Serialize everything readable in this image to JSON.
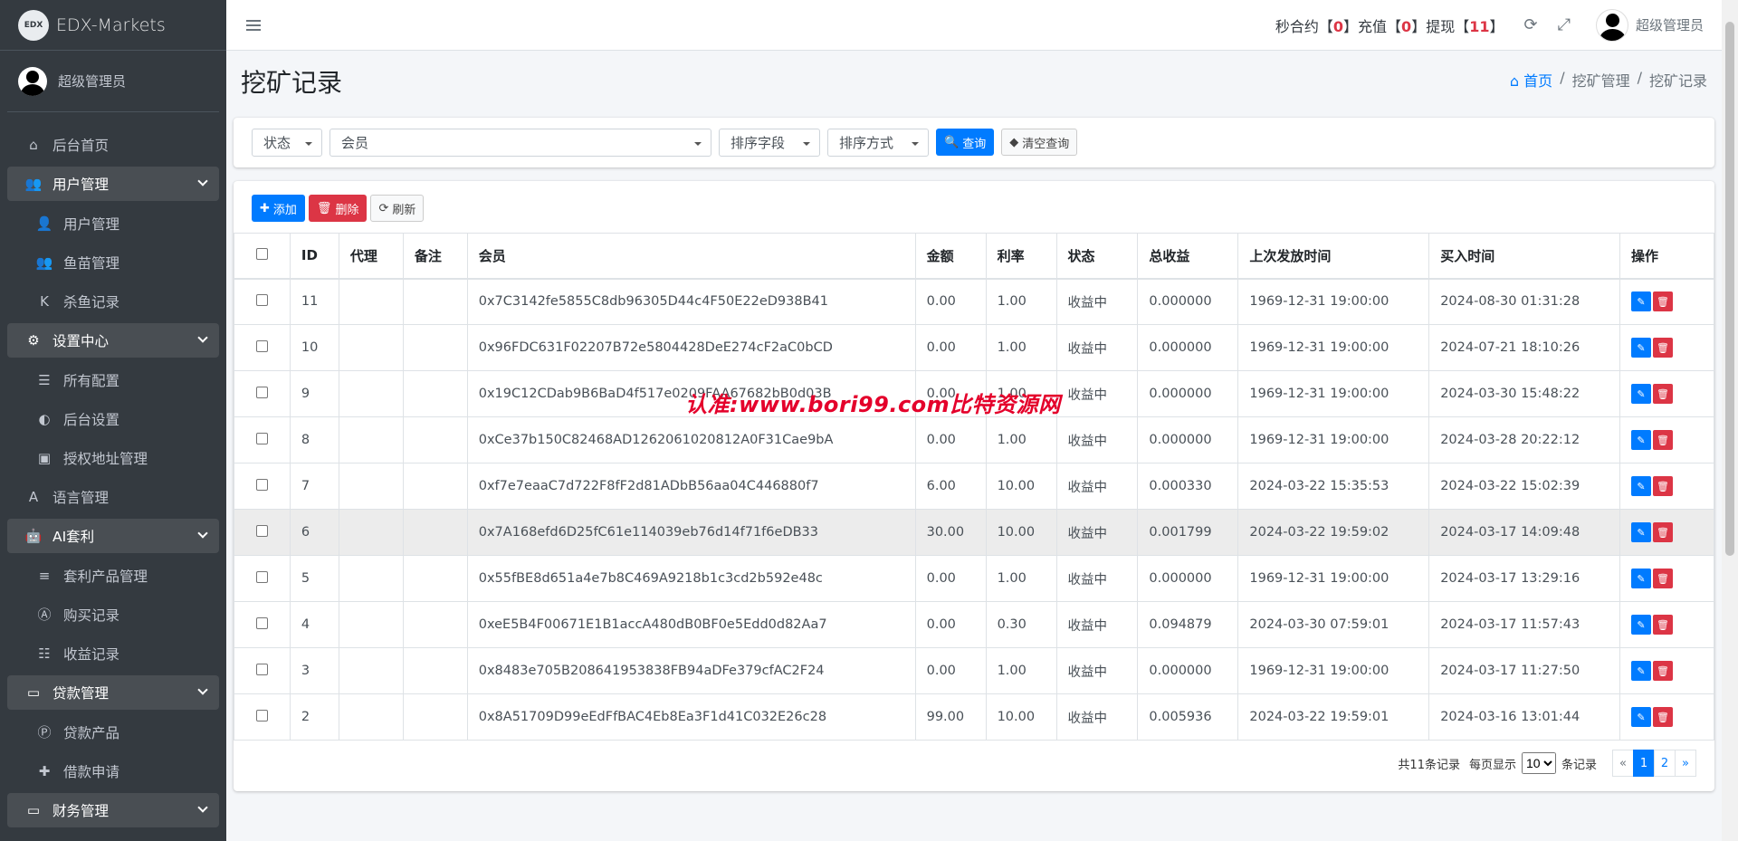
{
  "brand": {
    "logo": "EDX",
    "name": "EDX-Markets"
  },
  "sidebar": {
    "user_name": "超级管理员",
    "items": [
      {
        "label": "后台首页",
        "icon": "home-icon",
        "glyph": "⌂",
        "type": "top"
      },
      {
        "label": "用户管理",
        "icon": "users-icon",
        "glyph": "👥",
        "type": "parent"
      },
      {
        "label": "用户管理",
        "icon": "user-icon",
        "glyph": "👤",
        "type": "child"
      },
      {
        "label": "鱼苗管理",
        "icon": "users-icon",
        "glyph": "👥",
        "type": "child"
      },
      {
        "label": "杀鱼记录",
        "icon": "k-icon",
        "glyph": "K",
        "type": "child"
      },
      {
        "label": "设置中心",
        "icon": "cogs-icon",
        "glyph": "⚙",
        "type": "parent"
      },
      {
        "label": "所有配置",
        "icon": "list-icon",
        "glyph": "☰",
        "type": "child"
      },
      {
        "label": "后台设置",
        "icon": "adjust-icon",
        "glyph": "◐",
        "type": "child"
      },
      {
        "label": "授权地址管理",
        "icon": "id-card-icon",
        "glyph": "▣",
        "type": "child"
      },
      {
        "label": "语言管理",
        "icon": "language-icon",
        "glyph": "A",
        "type": "top"
      },
      {
        "label": "AI套利",
        "icon": "android-icon",
        "glyph": "🤖",
        "type": "parent"
      },
      {
        "label": "套利产品管理",
        "icon": "bars-icon",
        "glyph": "≡",
        "type": "child"
      },
      {
        "label": "购买记录",
        "icon": "a-box-icon",
        "glyph": "Ⓐ",
        "type": "child"
      },
      {
        "label": "收益记录",
        "icon": "list-check-icon",
        "glyph": "☷",
        "type": "child"
      },
      {
        "label": "贷款管理",
        "icon": "money-icon",
        "glyph": "▭",
        "type": "parent"
      },
      {
        "label": "贷款产品",
        "icon": "p-circle-icon",
        "glyph": "Ⓟ",
        "type": "child"
      },
      {
        "label": "借款申请",
        "icon": "ambulance-icon",
        "glyph": "✚",
        "type": "child"
      },
      {
        "label": "财务管理",
        "icon": "money-icon",
        "glyph": "▭",
        "type": "parent"
      }
    ]
  },
  "topbar": {
    "seconds_label": "秒合约【",
    "seconds_value": "0",
    "recharge_label": "】充值【",
    "recharge_value": "0",
    "withdraw_label": "】提现【",
    "withdraw_value": "11",
    "end_bracket": "】",
    "user_name": "超级管理员"
  },
  "page": {
    "title": "挖矿记录"
  },
  "breadcrumb": {
    "home": "首页",
    "sep": "/",
    "level1": "挖矿管理",
    "level2": "挖矿记录"
  },
  "filters": {
    "status": "状态",
    "member": "会员",
    "sort_field": "排序字段",
    "sort_order": "排序方式",
    "query": "查询",
    "clear": "清空查询"
  },
  "toolbar": {
    "add": "添加",
    "delete": "删除",
    "refresh": "刷新"
  },
  "table": {
    "headers": [
      "ID",
      "代理",
      "备注",
      "会员",
      "金额",
      "利率",
      "状态",
      "总收益",
      "上次发放时间",
      "买入时间",
      "操作"
    ],
    "rows": [
      [
        "11",
        "",
        "",
        "0x7C3142fe5855C8db96305D44c4F50E22eD938B41",
        "0.00",
        "1.00",
        "收益中",
        "0.000000",
        "1969-12-31 19:00:00",
        "2024-08-30 01:31:28"
      ],
      [
        "10",
        "",
        "",
        "0x96FDC631F02207B72e5804428DeE274cF2aC0bCD",
        "0.00",
        "1.00",
        "收益中",
        "0.000000",
        "1969-12-31 19:00:00",
        "2024-07-21 18:10:26"
      ],
      [
        "9",
        "",
        "",
        "0x19C12CDab9B6BaD4f517e0209FAA67682bB0d03B",
        "0.00",
        "1.00",
        "收益中",
        "0.000000",
        "1969-12-31 19:00:00",
        "2024-03-30 15:48:22"
      ],
      [
        "8",
        "",
        "",
        "0xCe37b150C82468AD1262061020812A0F31Cae9bA",
        "0.00",
        "1.00",
        "收益中",
        "0.000000",
        "1969-12-31 19:00:00",
        "2024-03-28 20:22:12"
      ],
      [
        "7",
        "",
        "",
        "0xf7e7eaaC7d722F8fF2d81ADbB56aa04C446880f7",
        "6.00",
        "10.00",
        "收益中",
        "0.000330",
        "2024-03-22 15:35:53",
        "2024-03-22 15:02:39"
      ],
      [
        "6",
        "",
        "",
        "0x7A168efd6D25fC61e114039eb76d14f71f6eDB33",
        "30.00",
        "10.00",
        "收益中",
        "0.001799",
        "2024-03-22 19:59:02",
        "2024-03-17 14:09:48"
      ],
      [
        "5",
        "",
        "",
        "0x55fBE8d651a4e7b8C469A9218b1c3cd2b592e48c",
        "0.00",
        "1.00",
        "收益中",
        "0.000000",
        "1969-12-31 19:00:00",
        "2024-03-17 13:29:16"
      ],
      [
        "4",
        "",
        "",
        "0xeE5B4F00671E1B1accA480dB0BF0e5Edd0d82Aa7",
        "0.00",
        "0.30",
        "收益中",
        "0.094879",
        "2024-03-30 07:59:01",
        "2024-03-17 11:57:43"
      ],
      [
        "3",
        "",
        "",
        "0x8483e705B208641953838FB94aDFe379cfAC2F24",
        "0.00",
        "1.00",
        "收益中",
        "0.000000",
        "1969-12-31 19:00:00",
        "2024-03-17 11:27:50"
      ],
      [
        "2",
        "",
        "",
        "0x8A51709D99eEdFfBAC4Eb8Ea3F1d41C032E26c28",
        "99.00",
        "10.00",
        "收益中",
        "0.005936",
        "2024-03-22 19:59:01",
        "2024-03-16 13:01:44"
      ]
    ]
  },
  "pagination": {
    "total": "共11条记录",
    "per_page_label": "每页显示",
    "per_page": "10",
    "suffix": "条记录",
    "prev": "«",
    "pages": [
      "1",
      "2"
    ],
    "next": "»"
  },
  "watermark": "认准:www.bori99.com比特资源网",
  "colors": {
    "primary": "#007bff",
    "danger": "#dc3545",
    "sidebar": "#343a40"
  }
}
